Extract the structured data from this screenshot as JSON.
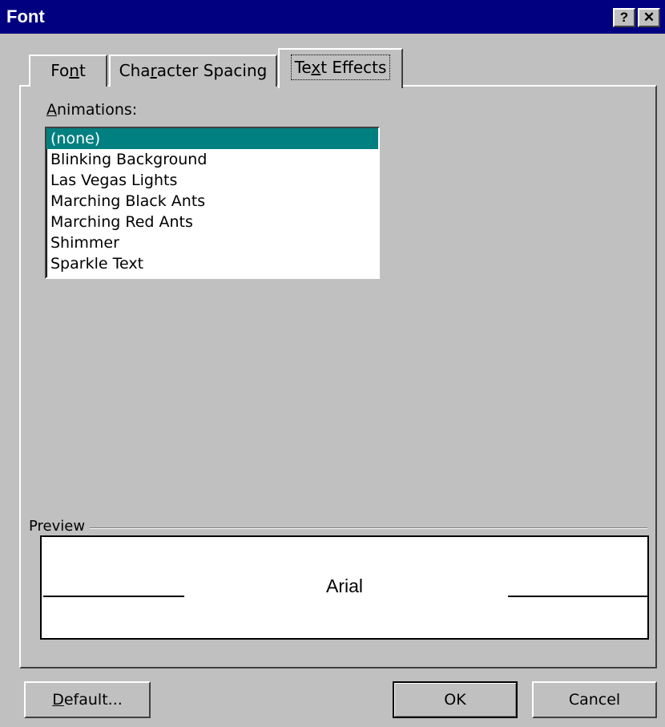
{
  "window": {
    "title": "Font",
    "help_button": "?",
    "close_button": "✕"
  },
  "tabs": [
    {
      "label": "Font",
      "selected": false
    },
    {
      "label": "Character Spacing",
      "selected": false
    },
    {
      "label": "Text Effects",
      "selected": true
    }
  ],
  "animations": {
    "label": "Animations:",
    "items": [
      "(none)",
      "Blinking Background",
      "Las Vegas Lights",
      "Marching Black Ants",
      "Marching Red Ants",
      "Shimmer",
      "Sparkle Text"
    ],
    "selected": "(none)"
  },
  "preview": {
    "label": "Preview",
    "sample_text": "Arial"
  },
  "buttons": {
    "default": "Default...",
    "ok": "OK",
    "cancel": "Cancel"
  },
  "colors": {
    "title_bar": "#000080",
    "selection": "#008080",
    "face": "#c0c0c0"
  }
}
